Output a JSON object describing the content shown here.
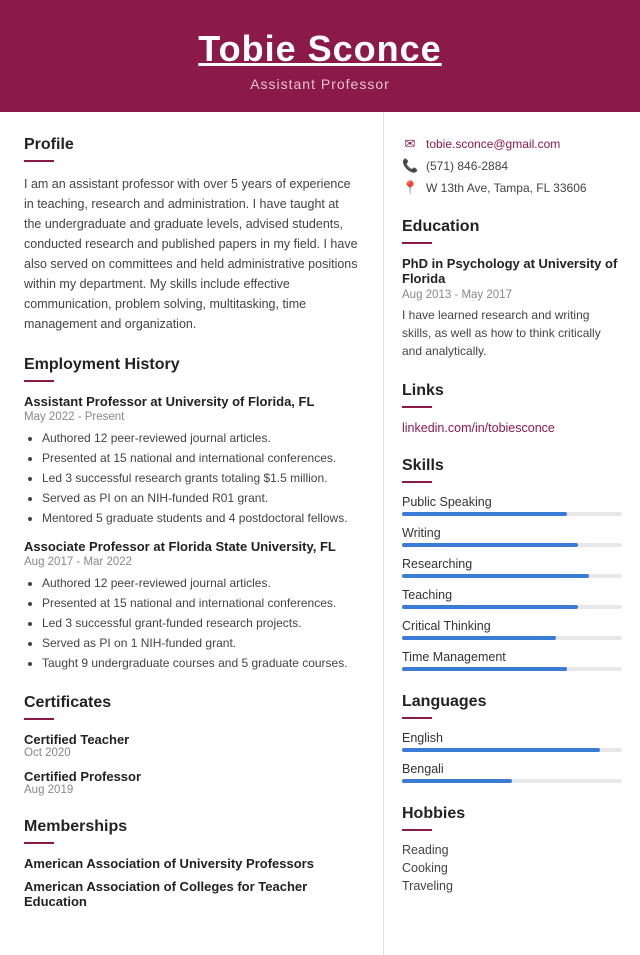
{
  "header": {
    "name": "Tobie Sconce",
    "title": "Assistant Professor"
  },
  "contact": {
    "email": "tobie.sconce@gmail.com",
    "phone": "(571) 846-2884",
    "address": "W 13th Ave, Tampa, FL 33606"
  },
  "profile": {
    "title": "Profile",
    "text": "I am an assistant professor with over 5 years of experience in teaching, research and administration. I have taught at the undergraduate and graduate levels, advised students, conducted research and published papers in my field. I have also served on committees and held administrative positions within my department. My skills include effective communication, problem solving, multitasking, time management and organization."
  },
  "employment": {
    "title": "Employment History",
    "jobs": [
      {
        "title": "Assistant Professor at University of Florida, FL",
        "dates": "May 2022 - Present",
        "bullets": [
          "Authored 12 peer-reviewed journal articles.",
          "Presented at 15 national and international conferences.",
          "Led 3 successful research grants totaling $1.5 million.",
          "Served as PI on an NIH-funded R01 grant.",
          "Mentored 5 graduate students and 4 postdoctoral fellows."
        ]
      },
      {
        "title": "Associate Professor at Florida State University, FL",
        "dates": "Aug 2017 - Mar 2022",
        "bullets": [
          "Authored 12 peer-reviewed journal articles.",
          "Presented at 15 national and international conferences.",
          "Led 3 successful grant-funded research projects.",
          "Served as PI on 1 NIH-funded grant.",
          "Taught 9 undergraduate courses and 5 graduate courses."
        ]
      }
    ]
  },
  "certificates": {
    "title": "Certificates",
    "items": [
      {
        "name": "Certified Teacher",
        "date": "Oct 2020"
      },
      {
        "name": "Certified Professor",
        "date": "Aug 2019"
      }
    ]
  },
  "memberships": {
    "title": "Memberships",
    "items": [
      "American Association of University Professors",
      "American Association of Colleges for Teacher Education"
    ]
  },
  "education": {
    "title": "Education",
    "degree": "PhD in Psychology at University of Florida",
    "dates": "Aug 2013 - May 2017",
    "text": "I have learned research and writing skills, as well as how to think critically and analytically."
  },
  "links": {
    "title": "Links",
    "items": [
      {
        "label": "linkedin.com/in/tobiesconce",
        "url": "https://linkedin.com/in/tobiesconce"
      }
    ]
  },
  "skills": {
    "title": "Skills",
    "items": [
      {
        "label": "Public Speaking",
        "percent": 75
      },
      {
        "label": "Writing",
        "percent": 80
      },
      {
        "label": "Researching",
        "percent": 85
      },
      {
        "label": "Teaching",
        "percent": 80
      },
      {
        "label": "Critical Thinking",
        "percent": 70
      },
      {
        "label": "Time Management",
        "percent": 75
      }
    ]
  },
  "languages": {
    "title": "Languages",
    "items": [
      {
        "label": "English",
        "percent": 90
      },
      {
        "label": "Bengali",
        "percent": 50
      }
    ]
  },
  "hobbies": {
    "title": "Hobbies",
    "items": [
      "Reading",
      "Cooking",
      "Traveling"
    ]
  }
}
